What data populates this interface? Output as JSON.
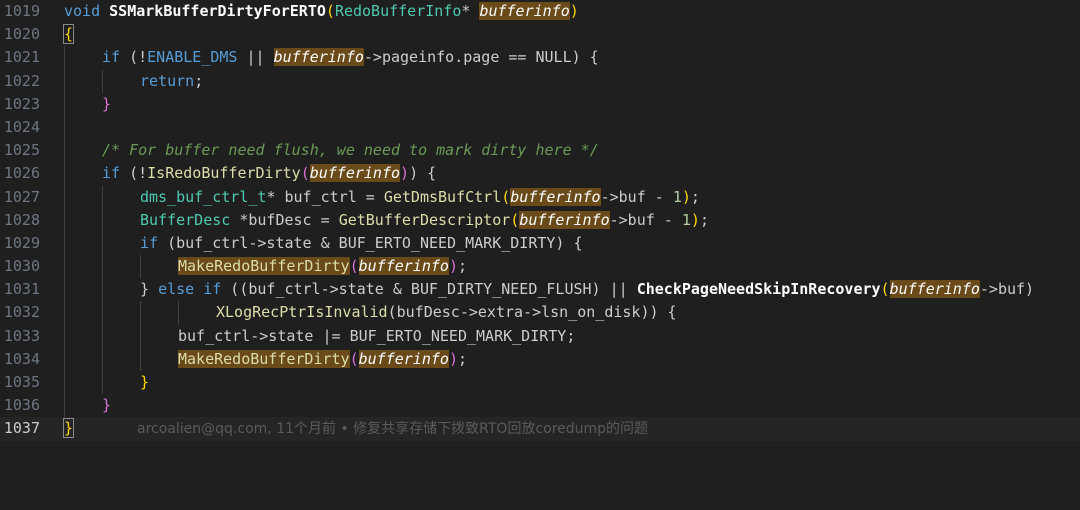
{
  "lines": [
    {
      "num": "1019"
    },
    {
      "num": "1020"
    },
    {
      "num": "1021"
    },
    {
      "num": "1022"
    },
    {
      "num": "1023"
    },
    {
      "num": "1024"
    },
    {
      "num": "1025"
    },
    {
      "num": "1026"
    },
    {
      "num": "1027"
    },
    {
      "num": "1028"
    },
    {
      "num": "1029"
    },
    {
      "num": "1030"
    },
    {
      "num": "1031"
    },
    {
      "num": "1032"
    },
    {
      "num": "1033"
    },
    {
      "num": "1034"
    },
    {
      "num": "1035"
    },
    {
      "num": "1036"
    },
    {
      "num": "1037"
    }
  ],
  "code": {
    "l1019": {
      "kw": "void",
      "fn": "SSMarkBufferDirtyForERTO",
      "p1": "(",
      "ty": "RedoBufferInfo",
      "star": "* ",
      "arg": "bufferinfo",
      "p2": ")"
    },
    "l1020": {
      "brace": "{"
    },
    "l1021": {
      "kw": "if",
      "a": " (!",
      "macro": "ENABLE_DMS",
      "b": " || ",
      "arg": "bufferinfo",
      "c": "->pageinfo.page == NULL) {"
    },
    "l1022": {
      "kw": "return",
      "a": ";"
    },
    "l1023": {
      "a": "}"
    },
    "l1024": {},
    "l1025": {
      "cm": "/* For buffer need flush, we need to mark dirty here */"
    },
    "l1026": {
      "kw": "if",
      "a": " (!",
      "fn": "IsRedoBufferDirty",
      "p1": "(",
      "arg": "bufferinfo",
      "p2": ")",
      "b": ") {"
    },
    "l1027": {
      "ty": "dms_buf_ctrl_t",
      "a": "* buf_ctrl = ",
      "fn": "GetDmsBufCtrl",
      "p1": "(",
      "arg": "bufferinfo",
      "b": "->buf - ",
      "num": "1",
      "p2": ")",
      "c": ";"
    },
    "l1028": {
      "ty": "BufferDesc",
      "a": " *bufDesc = ",
      "fn": "GetBufferDescriptor",
      "p1": "(",
      "arg": "bufferinfo",
      "b": "->buf - ",
      "num": "1",
      "p2": ")",
      "c": ";"
    },
    "l1029": {
      "kw": "if",
      "a": " (buf_ctrl->state & BUF_ERTO_NEED_MARK_DIRTY) {"
    },
    "l1030": {
      "fn": "MakeRedoBufferDirty",
      "p1": "(",
      "arg": "bufferinfo",
      "p2": ")",
      "a": ";"
    },
    "l1031": {
      "a": "} ",
      "kw": "else if",
      "b": " ((buf_ctrl->state & BUF_DIRTY_NEED_FLUSH) || ",
      "fn": "CheckPageNeedSkipInRecovery",
      "p1": "(",
      "arg": "bufferinfo",
      "c": "->buf)"
    },
    "l1032": {
      "fn": "XLogRecPtrIsInvalid",
      "a": "(bufDesc->extra->lsn_on_disk)) {"
    },
    "l1033": {
      "a": "buf_ctrl->state |= BUF_ERTO_NEED_MARK_DIRTY;"
    },
    "l1034": {
      "fn": "MakeRedoBufferDirty",
      "p1": "(",
      "arg": "bufferinfo",
      "p2": ")",
      "a": ";"
    },
    "l1035": {
      "a": "}"
    },
    "l1036": {
      "a": "}"
    },
    "l1037": {
      "brace": "}",
      "blame": "arcoalien@qq.com, 11个月前 • 修复共享存储下拨致RTO回放coredump的问题"
    }
  }
}
